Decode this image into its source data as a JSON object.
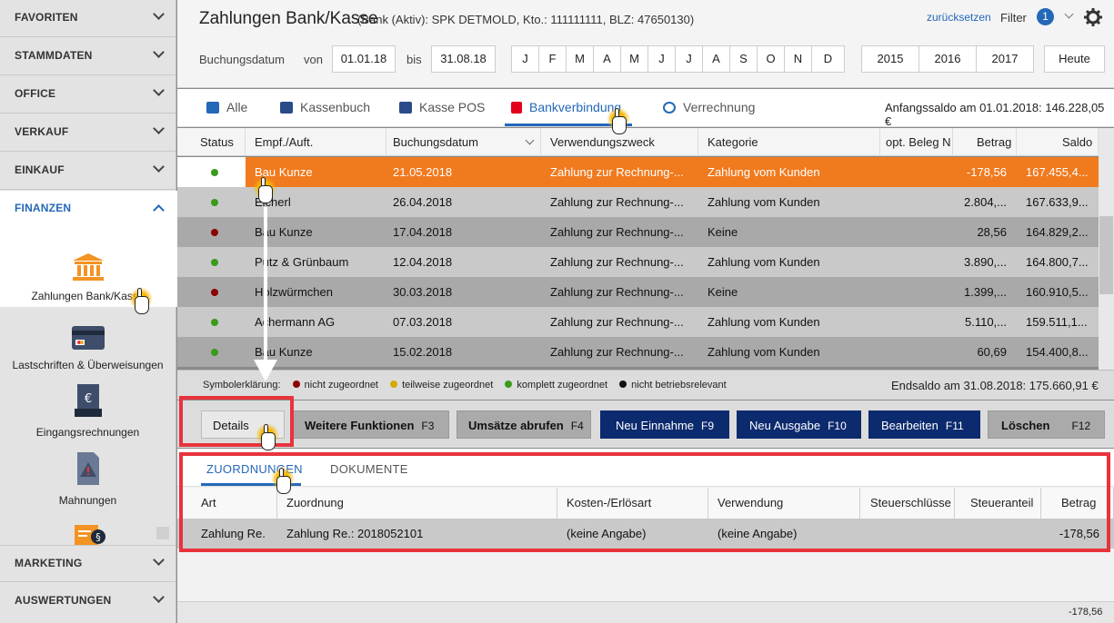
{
  "sidebar": {
    "sections": [
      {
        "label": "FAVORITEN"
      },
      {
        "label": "STAMMDATEN"
      },
      {
        "label": "OFFICE"
      },
      {
        "label": "VERKAUF"
      },
      {
        "label": "EINKAUF"
      },
      {
        "label": "FINANZEN"
      },
      {
        "label": "MARKETING"
      },
      {
        "label": "AUSWERTUNGEN"
      }
    ],
    "modules": [
      {
        "label": "Zahlungen Bank/Kasse",
        "icon": "bank-icon"
      },
      {
        "label": "Lastschriften & Überweisungen",
        "icon": "card-icon"
      },
      {
        "label": "Eingangsrechnungen",
        "icon": "invoice-icon"
      },
      {
        "label": "Mahnungen",
        "icon": "warning-doc-icon"
      }
    ]
  },
  "header": {
    "title": "Zahlungen Bank/Kasse",
    "subtitle": "(Bank (Aktiv): SPK DETMOLD, Kto.: 111111111, BLZ: 47650130)",
    "reset": "zurücksetzen",
    "filter": "Filter",
    "filter_count": "1",
    "date_label": "Buchungsdatum",
    "from_label": "von",
    "from_value": "01.01.18",
    "to_label": "bis",
    "to_value": "31.08.18",
    "months": [
      "J",
      "F",
      "M",
      "A",
      "M",
      "J",
      "J",
      "A",
      "S",
      "O",
      "N",
      "D"
    ],
    "years": [
      "2015",
      "2016",
      "2017"
    ],
    "today": "Heute"
  },
  "tabs": {
    "items": [
      {
        "label": "Alle",
        "icon": "folder-icon"
      },
      {
        "label": "Kassenbuch",
        "icon": "cashbook-icon"
      },
      {
        "label": "Kasse POS",
        "icon": "pos-icon"
      },
      {
        "label": "Bankverbindung",
        "icon": "sparkasse-icon"
      },
      {
        "label": "Verrechnung",
        "icon": "exchange-icon"
      }
    ],
    "opening_balance": "Anfangssaldo am 01.01.2018: 146.228,05 €"
  },
  "table": {
    "columns": [
      "Status",
      "Empf./Auft.",
      "Buchungsdatum",
      "Verwendungszweck",
      "Kategorie",
      "opt. Beleg N",
      "Betrag",
      "Saldo"
    ],
    "rows": [
      {
        "status": "green",
        "party": "Bau Kunze",
        "date": "21.05.2018",
        "purpose": "Zahlung zur Rechnung-...",
        "category": "Zahlung vom Kunden",
        "amount": "-178,56",
        "balance": "167.455,4..."
      },
      {
        "status": "green",
        "party": "Eicherl",
        "date": "26.04.2018",
        "purpose": "Zahlung zur Rechnung-...",
        "category": "Zahlung vom Kunden",
        "amount": "2.804,...",
        "balance": "167.633,9..."
      },
      {
        "status": "red",
        "party": "Bau Kunze",
        "date": "17.04.2018",
        "purpose": "Zahlung zur Rechnung-...",
        "category": "Keine",
        "amount": "28,56",
        "balance": "164.829,2..."
      },
      {
        "status": "green",
        "party": "Putz & Grünbaum",
        "date": "12.04.2018",
        "purpose": "Zahlung zur Rechnung-...",
        "category": "Zahlung vom Kunden",
        "amount": "3.890,...",
        "balance": "164.800,7..."
      },
      {
        "status": "red",
        "party": "Holzwürmchen",
        "date": "30.03.2018",
        "purpose": "Zahlung zur Rechnung-...",
        "category": "Keine",
        "amount": "1.399,...",
        "balance": "160.910,5..."
      },
      {
        "status": "green",
        "party": "Achermann AG",
        "date": "07.03.2018",
        "purpose": "Zahlung zur Rechnung-...",
        "category": "Zahlung vom Kunden",
        "amount": "5.110,...",
        "balance": "159.511,1..."
      },
      {
        "status": "green",
        "party": "Bau Kunze",
        "date": "15.02.2018",
        "purpose": "Zahlung zur Rechnung-...",
        "category": "Zahlung vom Kunden",
        "amount": "60,69",
        "balance": "154.400,8..."
      }
    ]
  },
  "legend": {
    "title": "Symbolerklärung:",
    "items": [
      {
        "label": "nicht zugeordnet",
        "color": "#8b0000"
      },
      {
        "label": "teilweise zugeordnet",
        "color": "#d4a900"
      },
      {
        "label": "komplett zugeordnet",
        "color": "#3a9a1a"
      },
      {
        "label": "nicht betriebsrelevant",
        "color": "#111111"
      }
    ],
    "closing_balance": "Endsaldo am 31.08.2018: 175.660,91 €"
  },
  "actions": [
    {
      "label": "Details",
      "key": ""
    },
    {
      "label": "Weitere Funktionen",
      "key": "F3"
    },
    {
      "label": "Umsätze abrufen",
      "key": "F4"
    },
    {
      "label": "Neu Einnahme",
      "key": "F9"
    },
    {
      "label": "Neu Ausgabe",
      "key": "F10"
    },
    {
      "label": "Bearbeiten",
      "key": "F11"
    },
    {
      "label": "Löschen",
      "key": "F12"
    }
  ],
  "detail": {
    "tabs": [
      "ZUORDNUNGEN",
      "DOKUMENTE"
    ],
    "columns": [
      "Art",
      "Zuordnung",
      "Kosten-/Erlösart",
      "Verwendung",
      "Steuerschlüsse",
      "Steueranteil",
      "Betrag"
    ],
    "row": {
      "art": "Zahlung Re.",
      "zuordnung": "Zahlung Re.: 2018052101",
      "kosten": "(keine Angabe)",
      "verwendung": "(keine Angabe)",
      "steuer": "",
      "anteil": "",
      "betrag": "-178,56"
    },
    "footer_sum": "-178,56"
  },
  "colors": {
    "accent": "#2468b8",
    "selected_row": "#f07a1e",
    "navy": "#0c2a6e",
    "highlight": "#e8333b"
  }
}
